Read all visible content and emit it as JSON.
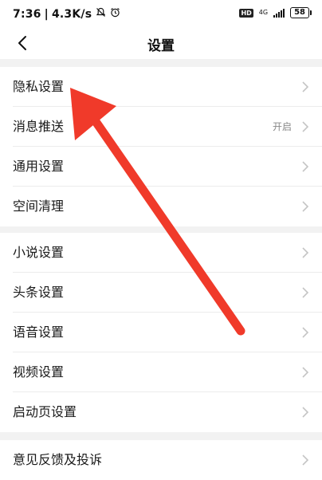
{
  "status_bar": {
    "time": "7:36",
    "separator": "|",
    "speed": "4.3K/s",
    "hd": "HD",
    "network": "4G",
    "battery": "58"
  },
  "header": {
    "title": "设置"
  },
  "groups": [
    {
      "items": [
        {
          "label": "隐私设置",
          "value": ""
        },
        {
          "label": "消息推送",
          "value": "开启"
        },
        {
          "label": "通用设置",
          "value": ""
        },
        {
          "label": "空间清理",
          "value": ""
        }
      ]
    },
    {
      "items": [
        {
          "label": "小说设置",
          "value": ""
        },
        {
          "label": "头条设置",
          "value": ""
        },
        {
          "label": "语音设置",
          "value": ""
        },
        {
          "label": "视频设置",
          "value": ""
        },
        {
          "label": "启动页设置",
          "value": ""
        }
      ]
    },
    {
      "items": [
        {
          "label": "意见反馈及投诉",
          "value": ""
        }
      ]
    }
  ],
  "colors": {
    "arrow": "#f03a2a",
    "chevron": "#c4c4c4",
    "background": "#f2f2f2"
  },
  "icons": {
    "back": "back-arrow-icon",
    "chevron": "chevron-right-icon",
    "mute": "bell-mute-icon",
    "alarm": "alarm-clock-icon",
    "signal": "signal-icon",
    "battery": "battery-icon"
  }
}
